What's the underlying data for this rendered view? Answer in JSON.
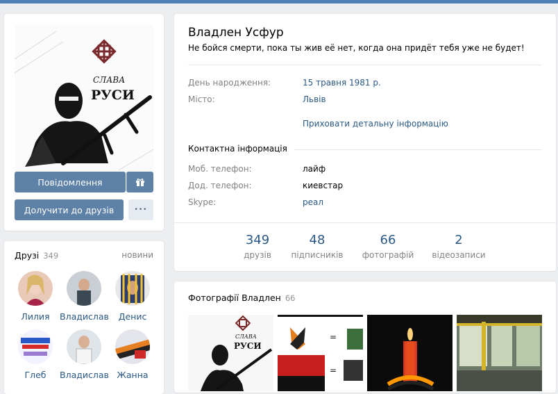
{
  "avatar": {
    "logo_text_1": "СЛАВА",
    "logo_text_2": "РУСИ"
  },
  "actions": {
    "message_label": "Повідомлення",
    "add_friend_label": "Долучити до друзів",
    "more_label": "•••"
  },
  "friends": {
    "title": "Друзі",
    "count": "349",
    "news_link": "новини",
    "items": [
      {
        "name": "Лилия"
      },
      {
        "name": "Владислав"
      },
      {
        "name": "Денис"
      },
      {
        "name": "Глеб"
      },
      {
        "name": "Владислав"
      },
      {
        "name": "Жанна"
      }
    ]
  },
  "profile": {
    "name": "Владлен Усфур",
    "status": "Не бойся смерти, пока ты жив её нет, когда она придёт тебя уже не будет!",
    "birthday_label": "День народження:",
    "birthday_value": "15 травня 1981 р.",
    "city_label": "Місто:",
    "city_value": "Львів",
    "toggle_details": "Приховати детальну інформацію",
    "contacts_title": "Контактна інформація",
    "mobile_label": "Моб. телефон:",
    "mobile_value": "лайф",
    "home_label": "Дод. телефон:",
    "home_value": "киевстар",
    "skype_label": "Skype:",
    "skype_value": "реал"
  },
  "counters": [
    {
      "value": "349",
      "label": "друзів"
    },
    {
      "value": "48",
      "label": "підписників"
    },
    {
      "value": "66",
      "label": "фотографій"
    },
    {
      "value": "2",
      "label": "відеозаписи"
    }
  ],
  "photos": {
    "title": "Фотографії Владлен",
    "count": "66"
  },
  "colors": {
    "accent": "#5181b8",
    "button": "#5e81a8",
    "link": "#2a5885",
    "page_bg": "#edeef0"
  }
}
